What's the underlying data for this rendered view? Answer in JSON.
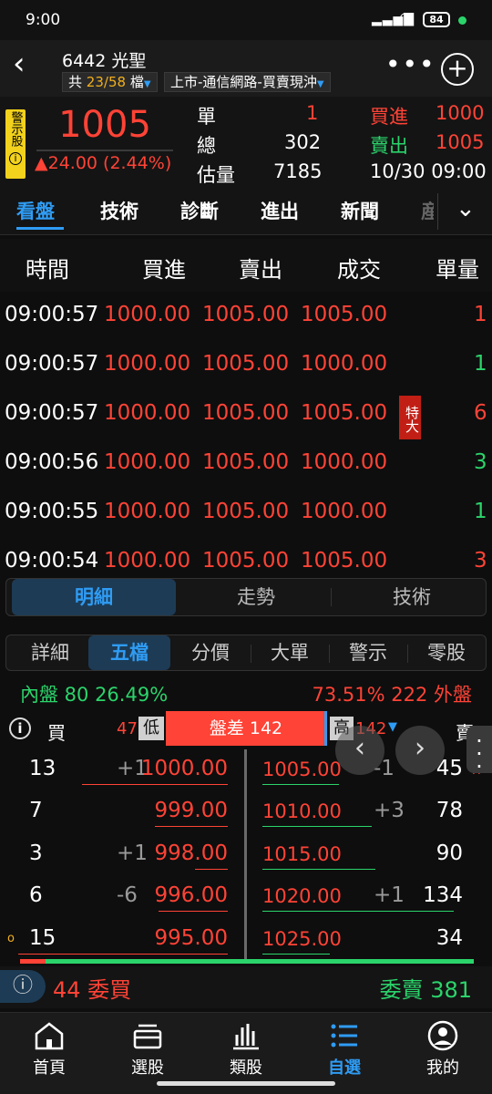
{
  "status": {
    "time": "9:00",
    "battery": "84"
  },
  "header": {
    "title": "6442 光聖",
    "count_prefix": "共",
    "count_value": "23/58",
    "count_suffix": "檔",
    "market": "上市-通信網路-買賣現沖"
  },
  "quote": {
    "warning_label": "警示股",
    "price": "1005",
    "change": "▲24.00 (2.44%)",
    "single_label": "單",
    "single_value": "1",
    "total_label": "總",
    "total_value": "302",
    "est_label": "估量",
    "est_value": "7185",
    "bid_label": "買進",
    "bid_value": "1000",
    "ask_label": "賣出",
    "ask_value": "1005",
    "datetime": "10/30 09:00"
  },
  "main_tabs": [
    "看盤",
    "技術",
    "診斷",
    "進出",
    "新聞",
    "産"
  ],
  "trade_table": {
    "headers": [
      "時間",
      "買進",
      "賣出",
      "成交",
      "單量"
    ],
    "rows": [
      {
        "time": "09:00:57",
        "bid": "1000.00",
        "ask": "1005.00",
        "deal": "1005.00",
        "qty": "1",
        "qty_color": "red",
        "badge": ""
      },
      {
        "time": "09:00:57",
        "bid": "1000.00",
        "ask": "1005.00",
        "deal": "1000.00",
        "qty": "1",
        "qty_color": "green",
        "badge": ""
      },
      {
        "time": "09:00:57",
        "bid": "1000.00",
        "ask": "1005.00",
        "deal": "1005.00",
        "qty": "6",
        "qty_color": "red",
        "badge": "特大"
      },
      {
        "time": "09:00:56",
        "bid": "1000.00",
        "ask": "1005.00",
        "deal": "1000.00",
        "qty": "3",
        "qty_color": "green",
        "badge": ""
      },
      {
        "time": "09:00:55",
        "bid": "1000.00",
        "ask": "1005.00",
        "deal": "1000.00",
        "qty": "1",
        "qty_color": "green",
        "badge": ""
      },
      {
        "time": "09:00:54",
        "bid": "1000.00",
        "ask": "1005.00",
        "deal": "1005.00",
        "qty": "3",
        "qty_color": "red",
        "badge": ""
      }
    ]
  },
  "view_toggle": [
    "明細",
    "走勢",
    "技術"
  ],
  "book_tabs": [
    "詳細",
    "五檔",
    "分價",
    "大單",
    "警示",
    "零股"
  ],
  "inout": {
    "inner": "內盤 80 26.49%",
    "outer": "73.51% 222 外盤"
  },
  "spread": {
    "buy_label": "買",
    "low_value": "47",
    "low_label": "低",
    "spread_text": "盤差 142",
    "high_label": "高",
    "high_value": "142",
    "sell_label": "賣"
  },
  "order_book": [
    {
      "bid_qty": "13",
      "bid_chg": "+1",
      "bid_price": "1000.00",
      "ask_price": "1005.00",
      "ask_chg": "-1",
      "ask_qty": "45",
      "marker": "",
      "ask_marker": "H"
    },
    {
      "bid_qty": "7",
      "bid_chg": "",
      "bid_price": "999.00",
      "ask_price": "1010.00",
      "ask_chg": "+3",
      "ask_qty": "78",
      "marker": "",
      "ask_marker": ""
    },
    {
      "bid_qty": "3",
      "bid_chg": "+1",
      "bid_price": "998.00",
      "ask_price": "1015.00",
      "ask_chg": "",
      "ask_qty": "90",
      "marker": "",
      "ask_marker": ""
    },
    {
      "bid_qty": "6",
      "bid_chg": "-6",
      "bid_price": "996.00",
      "ask_price": "1020.00",
      "ask_chg": "+1",
      "ask_qty": "134",
      "marker": "",
      "ask_marker": ""
    },
    {
      "bid_qty": "15",
      "bid_chg": "",
      "bid_price": "995.00",
      "ask_price": "1025.00",
      "ask_chg": "",
      "ask_qty": "34",
      "marker": "o",
      "ask_marker": ""
    }
  ],
  "totals": {
    "bid": "44 委買",
    "ask": "委賣 381"
  },
  "bottom_nav": [
    "首頁",
    "選股",
    "類股",
    "自選",
    "我的"
  ],
  "colors": {
    "up": "#ff4336",
    "down": "#2bd46b",
    "accent": "#2f9cf4",
    "warn": "#f2d21c"
  }
}
